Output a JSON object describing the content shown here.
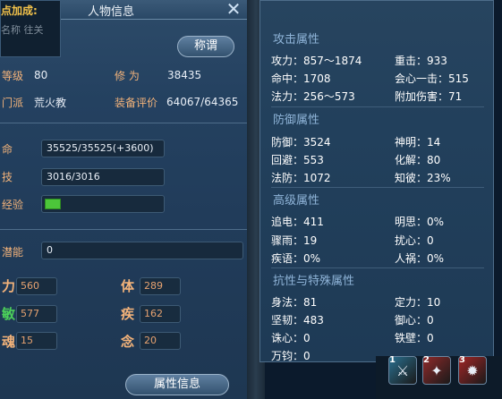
{
  "window": {
    "title": "人物信息",
    "title_button": "称谓",
    "bottom_button": "属性信息"
  },
  "tooltip": {
    "title": "点加成:",
    "line": "名称  往关"
  },
  "profile": {
    "level_label": "等级",
    "level": "80",
    "cultivation_label": "修  为",
    "cultivation": "38435",
    "faction_label": "门派",
    "faction": "荒火教",
    "gear_score_label": "装备评价",
    "gear_score": "64067/64365"
  },
  "vitals": {
    "hp_label": "命",
    "hp": "35525/35525(+3600)",
    "mp_label": "技",
    "mp": "3016/3016",
    "exp_label": "经验",
    "exp_fraction": 0.07,
    "potential_label": "潜能",
    "potential": "0"
  },
  "attributes": [
    {
      "label": "力",
      "value": "560"
    },
    {
      "label": "体",
      "value": "289"
    },
    {
      "label": "敏",
      "value": "577"
    },
    {
      "label": "疾",
      "value": "162"
    },
    {
      "label": "魂",
      "value": "15"
    },
    {
      "label": "念",
      "value": "20"
    }
  ],
  "attack": {
    "title": "攻击属性",
    "rows": [
      [
        "攻力：857～1874",
        "重击：933"
      ],
      [
        "命中：1708",
        "会心一击：515"
      ],
      [
        "法力：256～573",
        "附加伤害：71"
      ]
    ]
  },
  "defense": {
    "title": "防御属性",
    "rows": [
      [
        "防御：3524",
        "神明：14"
      ],
      [
        "回避：553",
        "化解：80"
      ],
      [
        "法防：1072",
        "知彼：23%"
      ]
    ]
  },
  "advanced": {
    "title": "高级属性",
    "rows": [
      [
        "追电：411",
        "明思：0%"
      ],
      [
        "骤雨：19",
        "扰心：0"
      ],
      [
        "疾语：0%",
        "人祸：0%"
      ]
    ]
  },
  "resist": {
    "title": "抗性与特殊属性",
    "rows": [
      [
        "身法：81",
        "定力：10"
      ],
      [
        "坚韧：483",
        "御心：0"
      ],
      [
        "诛心：0",
        "铁壁：0"
      ],
      [
        "万钧：0",
        ""
      ]
    ]
  },
  "skills": [
    {
      "key": "1",
      "icon": "sword-skill-icon",
      "color": "#2a6f8f"
    },
    {
      "key": "2",
      "icon": "flame-skill-icon",
      "color": "#8f2a2a"
    },
    {
      "key": "3",
      "icon": "blood-skill-icon",
      "color": "#a12626"
    }
  ],
  "colors": {
    "label_orange": "#f3b37a",
    "section_blue": "#8fb4d8",
    "exp_green": "#4cc63a"
  }
}
